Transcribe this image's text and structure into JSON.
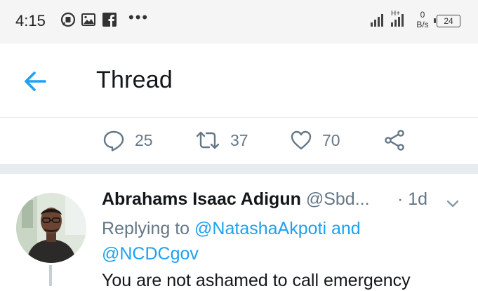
{
  "status_bar": {
    "time": "4:15",
    "net_type": "H+",
    "speed_value": "0",
    "speed_unit": "B/s",
    "battery": "24",
    "notification_icons": [
      "whatsapp-icon",
      "gallery-icon",
      "facebook-icon"
    ],
    "more": "•••"
  },
  "header": {
    "title": "Thread",
    "accent_color": "#1da1f2"
  },
  "actions": {
    "replies": "25",
    "retweets": "37",
    "likes": "70"
  },
  "tweet": {
    "author": "Abrahams Isaac Adigun",
    "handle": "@Sbd...",
    "time": "· 1d",
    "replying_prefix": "Replying to",
    "mention_1": "@NatashaAkpoti",
    "connector": "and",
    "mention_2": "@NCDCgov",
    "text": "You are not ashamed to call emergency"
  }
}
